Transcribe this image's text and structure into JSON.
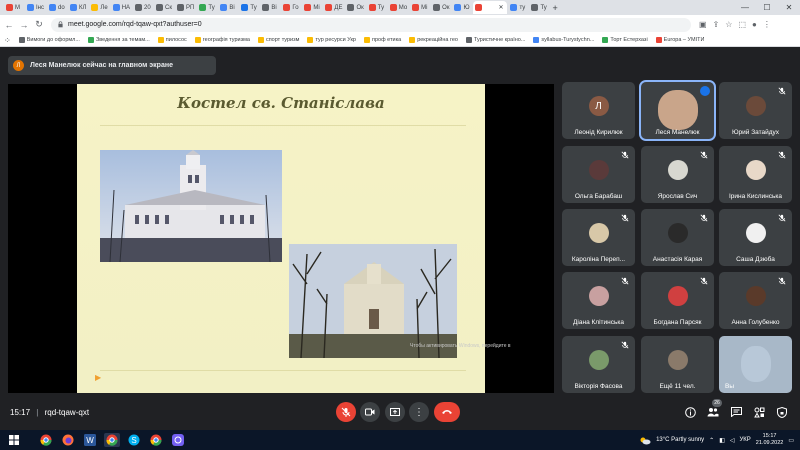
{
  "browser": {
    "tabs": [
      {
        "label": "M",
        "color": "#ea4335"
      },
      {
        "label": "Інс",
        "color": "#4285f4"
      },
      {
        "label": "do",
        "color": "#4285f4"
      },
      {
        "label": "КЛ",
        "color": "#4285f4"
      },
      {
        "label": "Ле",
        "color": "#fbbc04"
      },
      {
        "label": "НА",
        "color": "#4285f4"
      },
      {
        "label": "20",
        "color": "#5f6368"
      },
      {
        "label": "Ск",
        "color": "#5f6368"
      },
      {
        "label": "РП",
        "color": "#5f6368"
      },
      {
        "label": "Ту",
        "color": "#34a853"
      },
      {
        "label": "Ві",
        "color": "#4285f4"
      },
      {
        "label": "Ту",
        "color": "#1a73e8"
      },
      {
        "label": "Ві",
        "color": "#5f6368"
      },
      {
        "label": "Го",
        "color": "#ea4335"
      },
      {
        "label": "Мі",
        "color": "#ea4335"
      },
      {
        "label": "ДЕ",
        "color": "#ea4335"
      },
      {
        "label": "Ок",
        "color": "#5f6368"
      },
      {
        "label": "Ту",
        "color": "#ea4335"
      },
      {
        "label": "Мо",
        "color": "#ea4335"
      },
      {
        "label": "Мі",
        "color": "#ea4335"
      },
      {
        "label": "Ок",
        "color": "#5f6368"
      },
      {
        "label": "Ю",
        "color": "#4285f4"
      }
    ],
    "active_tab": {
      "label": "",
      "color": "#ea4335"
    },
    "trailing_tabs": [
      {
        "label": "ту",
        "color": "#4285f4"
      },
      {
        "label": "Ту",
        "color": "#5f6368"
      }
    ],
    "url": "meet.google.com/rqd-tqaw-qxt?authuser=0",
    "bookmarks": [
      {
        "label": "Вимоги до оформл...",
        "color": "#5f6368"
      },
      {
        "label": "Зведення за темам...",
        "color": "#34a853"
      },
      {
        "label": "пилосос",
        "color": "#fbbc04"
      },
      {
        "label": "географія туризма",
        "color": "#fbbc04"
      },
      {
        "label": "спорт туризм",
        "color": "#fbbc04"
      },
      {
        "label": "тур ресурси Укр",
        "color": "#fbbc04"
      },
      {
        "label": "проф етика",
        "color": "#fbbc04"
      },
      {
        "label": "рекреаційна гео",
        "color": "#fbbc04"
      },
      {
        "label": "Туристичне країно...",
        "color": "#5f6368"
      },
      {
        "label": "syllabus-Turystychn...",
        "color": "#4285f4"
      },
      {
        "label": "Торт Естерхазі",
        "color": "#34a853"
      },
      {
        "label": "Europa – УМІТИ",
        "color": "#ea4335"
      }
    ]
  },
  "meet": {
    "notice": {
      "avatar": "Л",
      "text": "Леся Манелюк сейчас на главном экране"
    },
    "slide": {
      "title": "Костел св. Станіслава",
      "caption": "Чтобы активировать Windows, перейдите в"
    },
    "tiles": [
      {
        "name": "Леонід Кирилюк",
        "avatar": "Л",
        "muted": false,
        "speaking": false,
        "face": "#8a5a44"
      },
      {
        "name": "Леся Манелюк",
        "avatar": "",
        "muted": false,
        "speaking": true,
        "face": "#c9a58a"
      },
      {
        "name": "Юрий Затайдух",
        "avatar": "",
        "muted": true,
        "speaking": false,
        "face": "#6b4a3a"
      },
      {
        "name": "Ольга Барабаш",
        "avatar": "",
        "muted": true,
        "speaking": false,
        "face": "#5a3a3a"
      },
      {
        "name": "Ярослав Сич",
        "avatar": "",
        "muted": true,
        "speaking": false,
        "face": "#d8d8d0"
      },
      {
        "name": "Ірина Кислинська",
        "avatar": "",
        "muted": true,
        "speaking": false,
        "face": "#e8d8c8"
      },
      {
        "name": "Кароліна Переп...",
        "avatar": "",
        "muted": true,
        "speaking": false,
        "face": "#d8c8a8"
      },
      {
        "name": "Анастасія Карая",
        "avatar": "",
        "muted": true,
        "speaking": false,
        "face": "#2a2a2a"
      },
      {
        "name": "Саша Дзюба",
        "avatar": "",
        "muted": true,
        "speaking": false,
        "face": "#f0f0f0"
      },
      {
        "name": "Діана Клітинська",
        "avatar": "",
        "muted": true,
        "speaking": false,
        "face": "#c8a0a0"
      },
      {
        "name": "Богдана Парсяк",
        "avatar": "",
        "muted": true,
        "speaking": false,
        "face": "#d04040"
      },
      {
        "name": "Анна Голубенко",
        "avatar": "",
        "muted": true,
        "speaking": false,
        "face": "#5a3a2a"
      },
      {
        "name": "Вікторія Фасова",
        "avatar": "",
        "muted": true,
        "speaking": false,
        "face": "#7a9a6a"
      },
      {
        "name": "Ещё 11 чел.",
        "avatar": "",
        "muted": false,
        "speaking": false,
        "face": "#8a7a6a"
      },
      {
        "name": "Вы",
        "avatar": "",
        "muted": false,
        "speaking": false,
        "face": "#b8c8d8"
      }
    ],
    "meeting_time": "15:17",
    "meeting_code": "rqd-tqaw-qxt",
    "participants_count": "26"
  },
  "taskbar": {
    "weather": "13°C  Partly sunny",
    "lang": "УКР",
    "time": "15:17",
    "date": "21.09.2022"
  },
  "colors": {
    "accent": "#8ab4f8",
    "danger": "#ea4335",
    "surface": "#3c4043"
  }
}
